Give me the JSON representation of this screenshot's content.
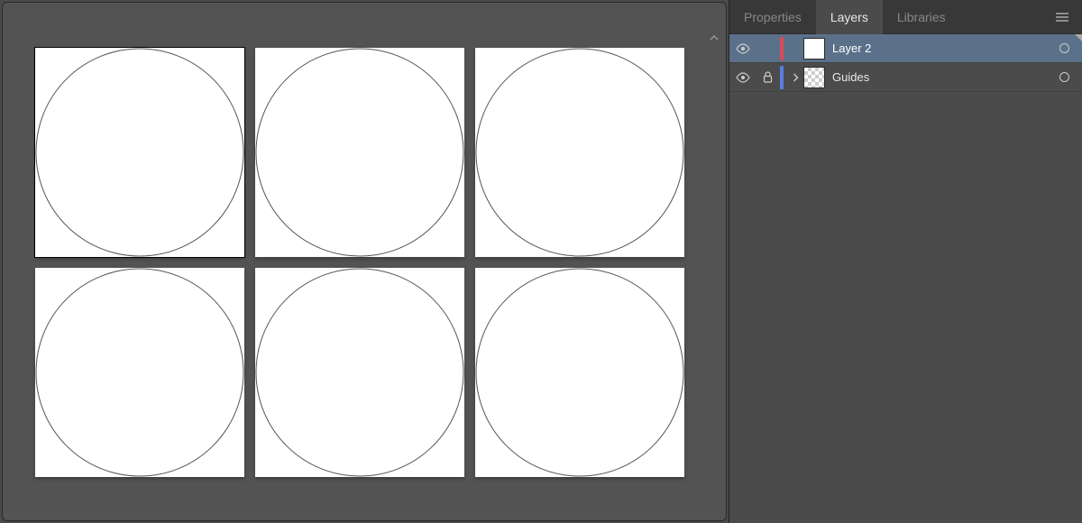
{
  "tabs": {
    "properties": "Properties",
    "layers": "Layers",
    "libraries": "Libraries",
    "active": "layers"
  },
  "layers": [
    {
      "name": "Layer 2",
      "color": "#d94b5b",
      "selected": true,
      "visible": true,
      "locked": false,
      "expandable": false,
      "thumb": "solid"
    },
    {
      "name": "Guides",
      "color": "#5a7de0",
      "selected": false,
      "visible": true,
      "locked": true,
      "expandable": true,
      "thumb": "transparent"
    }
  ],
  "artboards": {
    "rows": 2,
    "cols": 3,
    "selected_index": 0
  },
  "colors": {
    "panel_bg": "#383838",
    "panel_body": "#4b4b4b",
    "selected_row": "#5a7189",
    "canvas_bg": "#535353"
  }
}
